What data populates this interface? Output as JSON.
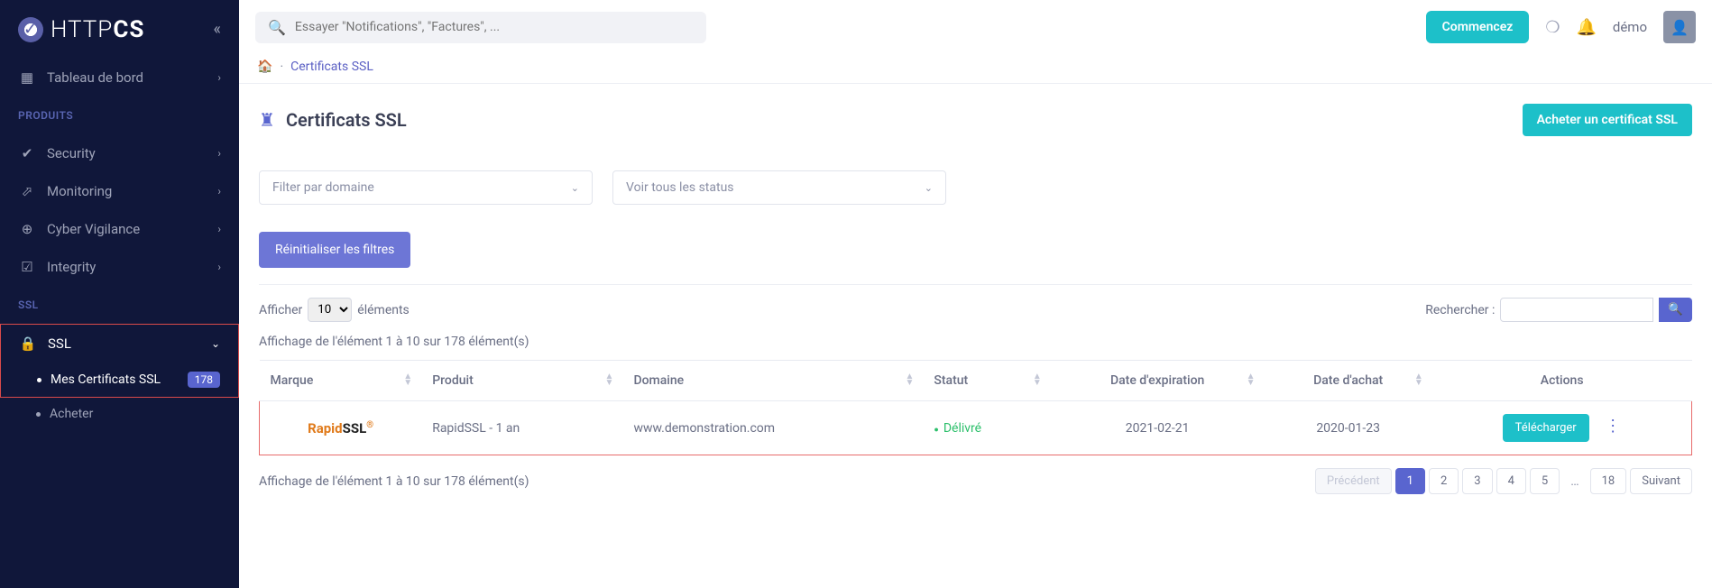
{
  "logo": {
    "brand_a": "HTTP",
    "brand_b": "CS"
  },
  "sidebar": {
    "dashboard": "Tableau de bord",
    "section_produits": "PRODUITS",
    "security": "Security",
    "monitoring": "Monitoring",
    "cyber": "Cyber Vigilance",
    "integrity": "Integrity",
    "section_ssl": "SSL",
    "ssl": "SSL",
    "mes_certs": "Mes Certificats SSL",
    "mes_certs_badge": "178",
    "acheter": "Acheter"
  },
  "search": {
    "placeholder": "Essayer \"Notifications\", \"Factures\", ..."
  },
  "topbar": {
    "start": "Commencez",
    "user": "démo"
  },
  "breadcrumb": {
    "home": "",
    "current": "Certificats SSL"
  },
  "page": {
    "title": "Certificats SSL",
    "buy": "Acheter un certificat SSL",
    "filter_domain": "Filter par domaine",
    "filter_status": "Voir tous les status",
    "reset": "Réinitialiser les filtres",
    "show_a": "Afficher",
    "show_b": "éléments",
    "show_val": "10",
    "search_label": "Rechercher :",
    "count": "Affichage de l'élément 1 à 10 sur 178 élément(s)"
  },
  "table": {
    "headers": {
      "marque": "Marque",
      "produit": "Produit",
      "domaine": "Domaine",
      "statut": "Statut",
      "expiration": "Date d'expiration",
      "achat": "Date d'achat",
      "actions": "Actions"
    },
    "row": {
      "produit": "RapidSSL - 1 an",
      "domaine": "www.demonstration.com",
      "statut": "Délivré",
      "expiration": "2021-02-21",
      "achat": "2020-01-23",
      "download": "Télécharger"
    }
  },
  "pagination": {
    "prev": "Précédent",
    "next": "Suivant",
    "pages": [
      "1",
      "2",
      "3",
      "4",
      "5"
    ],
    "last": "18",
    "ellipsis": "…"
  }
}
